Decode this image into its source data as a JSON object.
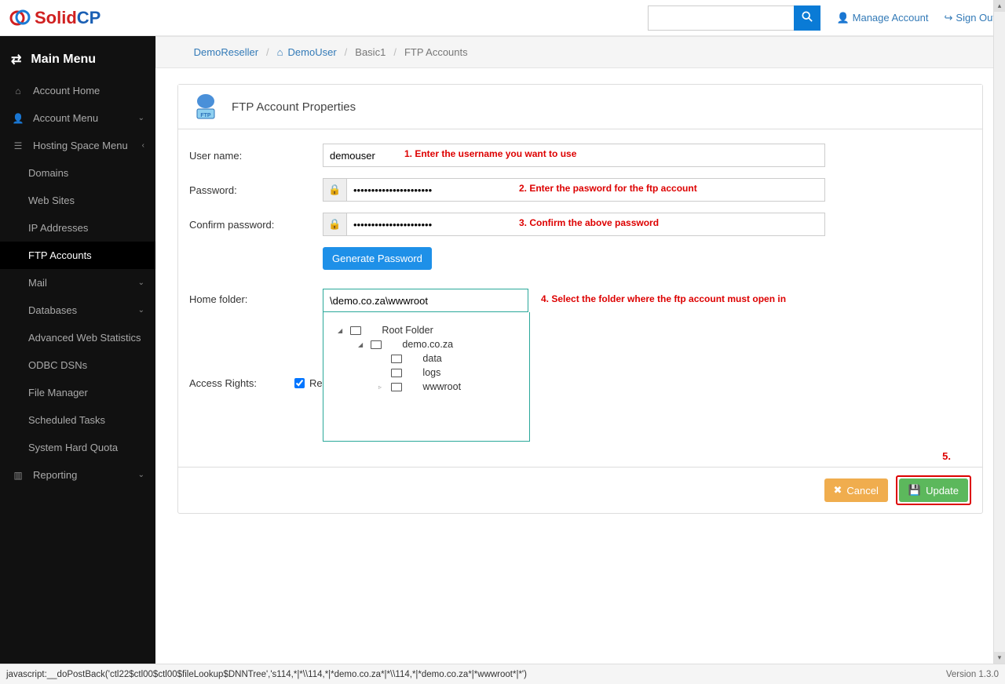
{
  "topbar": {
    "logo_part1": "Solid",
    "logo_part2": "CP",
    "manage_account": "Manage Account",
    "sign_out": "Sign Out"
  },
  "sidebar": {
    "title": "Main Menu",
    "items": [
      {
        "label": "Account Home"
      },
      {
        "label": "Account Menu"
      },
      {
        "label": "Hosting Space Menu"
      },
      {
        "label": "Domains"
      },
      {
        "label": "Web Sites"
      },
      {
        "label": "IP Addresses"
      },
      {
        "label": "FTP Accounts"
      },
      {
        "label": "Mail"
      },
      {
        "label": "Databases"
      },
      {
        "label": "Advanced Web Statistics"
      },
      {
        "label": "ODBC DSNs"
      },
      {
        "label": "File Manager"
      },
      {
        "label": "Scheduled Tasks"
      },
      {
        "label": "System Hard Quota"
      },
      {
        "label": "Reporting"
      }
    ]
  },
  "breadcrumb": {
    "a": "DemoReseller",
    "b": "DemoUser",
    "c": "Basic1",
    "d": "FTP Accounts"
  },
  "panel": {
    "title": "FTP Account Properties",
    "username_label": "User name:",
    "username_value": "demouser",
    "password_label": "Password:",
    "password_masked": "●●●●●●●●●●●●●●●●●●●●●●",
    "confirm_label": "Confirm password:",
    "generate_button": "Generate Password",
    "homefolder_label": "Home folder:",
    "homefolder_value": "\\demo.co.za\\wwwroot",
    "access_label": "Access Rights:",
    "access_option": "Re",
    "cancel": "Cancel",
    "update": "Update"
  },
  "tree": {
    "root": "Root Folder",
    "n1": "demo.co.za",
    "n2": "data",
    "n3": "logs",
    "n4": "wwwroot"
  },
  "hints": {
    "h1": "1. Enter the username you want to use",
    "h2": "2. Enter the pasword for the ftp account",
    "h3": "3. Confirm the above password",
    "h4": "4. Select the folder where the ftp account must open in",
    "h5": "5."
  },
  "status": {
    "js": "javascript:__doPostBack('ctl22$ctl00$ctl00$fileLookup$DNNTree','s114,*|*\\\\114,*|*demo.co.za*|*\\\\114,*|*demo.co.za*|*wwwroot*|*')",
    "version": "Version 1.3.0"
  }
}
